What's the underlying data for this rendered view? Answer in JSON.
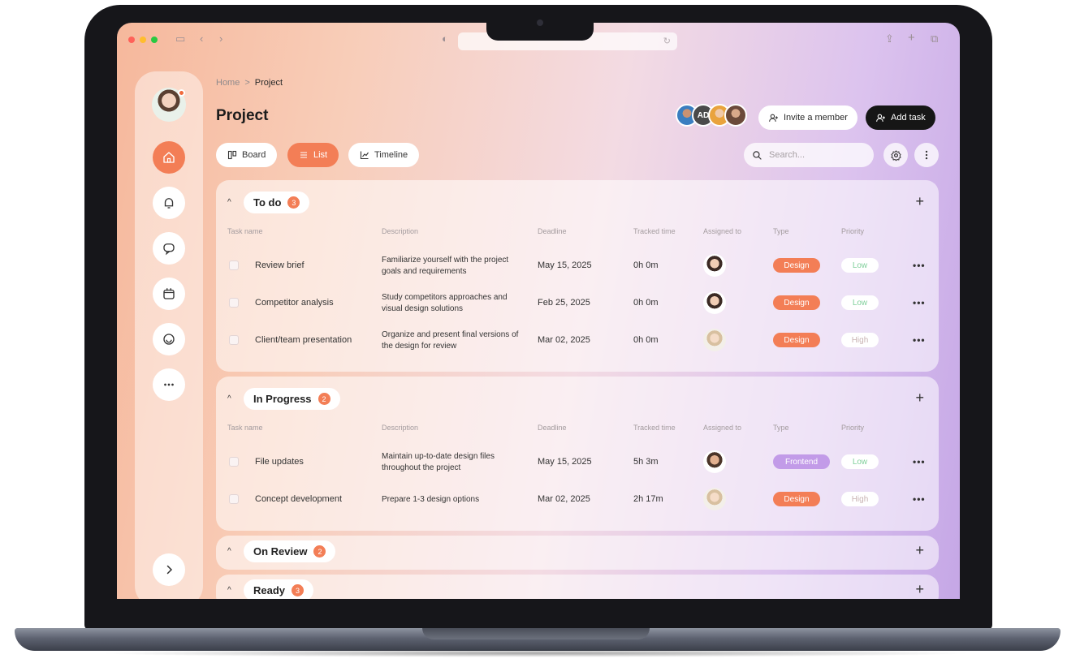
{
  "browser": {
    "url": ""
  },
  "breadcrumb": {
    "home": "Home",
    "separator": ">",
    "current": "Project"
  },
  "header": {
    "title": "Project",
    "avatar_initials": "AD",
    "invite_label": "Invite a member",
    "add_task_label": "Add task"
  },
  "views": [
    {
      "label": "Board",
      "icon": "board-icon"
    },
    {
      "label": "List",
      "icon": "list-icon",
      "active": true
    },
    {
      "label": "Timeline",
      "icon": "timeline-icon"
    }
  ],
  "search": {
    "placeholder": "Search..."
  },
  "columns": {
    "task_name": "Task name",
    "description": "Description",
    "deadline": "Deadline",
    "tracked_time": "Tracked time",
    "assigned_to": "Assigned to",
    "type": "Type",
    "priority": "Priority"
  },
  "groups": [
    {
      "name": "To do",
      "count": "3",
      "tasks": [
        {
          "name": "Review brief",
          "description": "Familiarize yourself with the project goals and requirements",
          "deadline": "May 15, 2025",
          "tracked": "0h 0m",
          "type": "Design",
          "priority": "Low"
        },
        {
          "name": "Competitor analysis",
          "description": "Study competitors approaches and visual design solutions",
          "deadline": "Feb 25, 2025",
          "tracked": "0h 0m",
          "type": "Design",
          "priority": "Low"
        },
        {
          "name": "Client/team presentation",
          "description": "Organize and present final versions of the design for review",
          "deadline": "Mar 02, 2025",
          "tracked": "0h 0m",
          "type": "Design",
          "priority": "High"
        }
      ]
    },
    {
      "name": "In Progress",
      "count": "2",
      "tasks": [
        {
          "name": "File updates",
          "description": "Maintain up-to-date design files throughout the project",
          "deadline": "May 15, 2025",
          "tracked": "5h 3m",
          "type": "Frontend",
          "priority": "Low"
        },
        {
          "name": "Concept development",
          "description": "Prepare 1-3 design options",
          "deadline": "Mar 02, 2025",
          "tracked": "2h 17m",
          "type": "Design",
          "priority": "High"
        }
      ]
    },
    {
      "name": "On Review",
      "count": "2"
    },
    {
      "name": "Ready",
      "count": "3"
    }
  ],
  "colors": {
    "accent": "#f37e56",
    "frontend_tag": "#c29be8",
    "low_priority": "#7fcf9a",
    "high_priority": "#c9b3b3",
    "dark_button": "#161616"
  }
}
